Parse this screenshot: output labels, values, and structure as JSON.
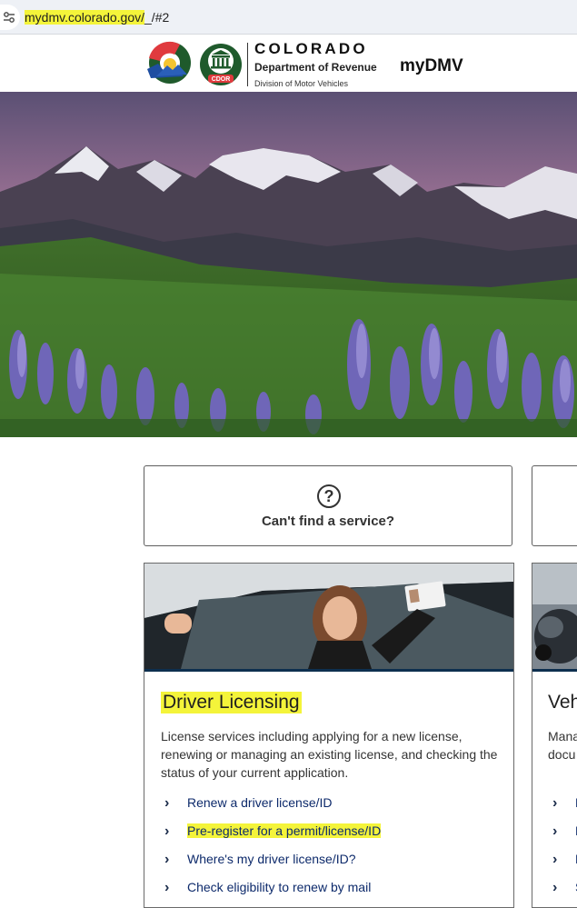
{
  "browser": {
    "url_highlighted": "mydmv.colorado.gov/",
    "url_rest": "_/#2",
    "site_info_icon": "tune-icon"
  },
  "header": {
    "colorado": "COLORADO",
    "department": "Department of Revenue",
    "division": "Division of Motor Vehicles",
    "cdor_badge": "CDOR",
    "app_name": "myDMV"
  },
  "help_card": {
    "icon": "question-circle-icon",
    "label": "Can't find a service?"
  },
  "driver_card": {
    "title": "Driver Licensing",
    "description": "License services including applying for a new license, renewing or managing an existing license, and checking the status of your current application.",
    "links": [
      {
        "label": "Renew a driver license/ID",
        "highlighted": false
      },
      {
        "label": "Pre-register for a permit/license/ID",
        "highlighted": true
      },
      {
        "label": "Where's my driver license/ID?",
        "highlighted": false
      },
      {
        "label": "Check eligibility to renew by mail",
        "highlighted": false
      }
    ]
  },
  "vehicle_card_partial": {
    "title": "Veh",
    "desc_line1": "Mana",
    "desc_line2": "docu",
    "link_fragments": [
      "R",
      "R",
      "R",
      "S"
    ]
  },
  "colors": {
    "highlight": "#f4f43a",
    "link": "#0d2a6b",
    "card_rule": "#0d2f4f"
  }
}
